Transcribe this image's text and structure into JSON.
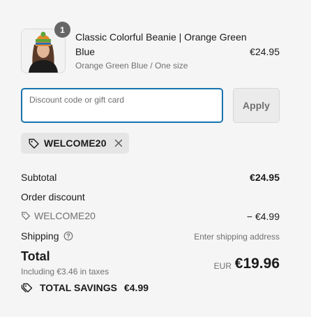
{
  "product": {
    "quantity": "1",
    "title": "Classic Colorful Beanie | Orange Green Blue",
    "variant": "Orange Green Blue / One size",
    "price": "€24.95",
    "image_icon": "beanie-model-photo"
  },
  "discount": {
    "placeholder": "Discount code or gift card",
    "value": "",
    "apply_label": "Apply",
    "applied_code": "WELCOME20"
  },
  "summary": {
    "subtotal_label": "Subtotal",
    "subtotal_value": "€24.95",
    "order_discount_label": "Order discount",
    "discount_code": "WELCOME20",
    "discount_value": "− €4.99",
    "shipping_label": "Shipping",
    "shipping_value": "Enter shipping address",
    "total_label": "Total",
    "taxes_text": "Including €3.46 in taxes",
    "currency": "EUR",
    "total_value": "€19.96",
    "savings_label": "TOTAL SAVINGS",
    "savings_value": "€4.99"
  },
  "colors": {
    "accent": "#1773b0",
    "background": "#f5f5f5",
    "muted_text": "#707070"
  }
}
